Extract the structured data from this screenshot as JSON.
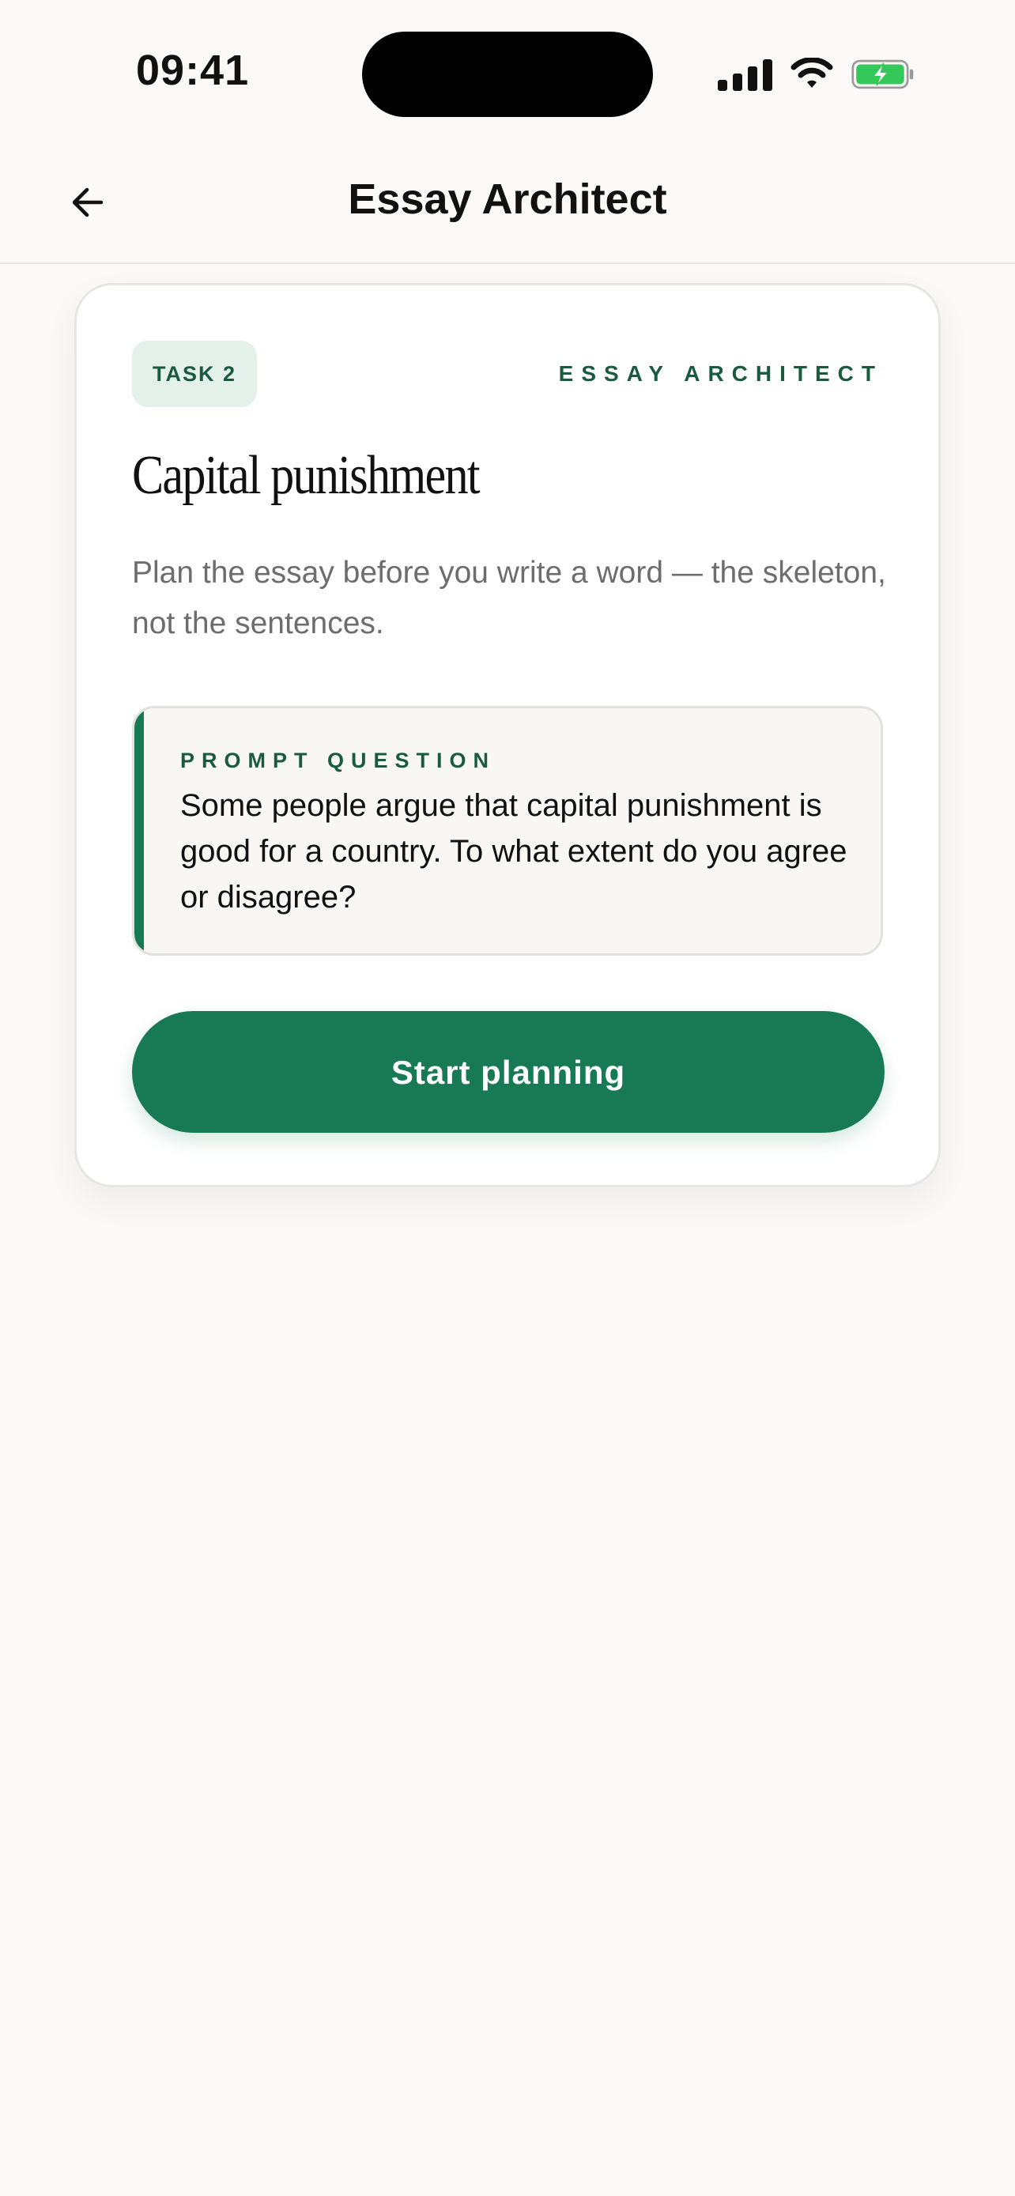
{
  "status_bar": {
    "time": "09:41",
    "icons": [
      "cellular-signal-icon",
      "wifi-icon",
      "battery-charging-icon"
    ],
    "battery_color": "#34c759"
  },
  "nav": {
    "back_icon": "arrow-left-icon",
    "title": "Essay Architect"
  },
  "card": {
    "badge": "TASK 2",
    "kicker": "ESSAY ARCHITECT",
    "title": "Capital punishment",
    "subtitle": "Plan the essay before you write a word — the skeleton, not the sentences.",
    "prompt": {
      "label": "PROMPT QUESTION",
      "text": "Some people argue that capital punishment is good for a country. To what extent do you agree or disagree?"
    },
    "cta_label": "Start planning"
  },
  "colors": {
    "accent": "#177a55",
    "accent_dark": "#1a5a3e",
    "badge_bg": "#e4f0ea",
    "background": "#faf9f7"
  }
}
